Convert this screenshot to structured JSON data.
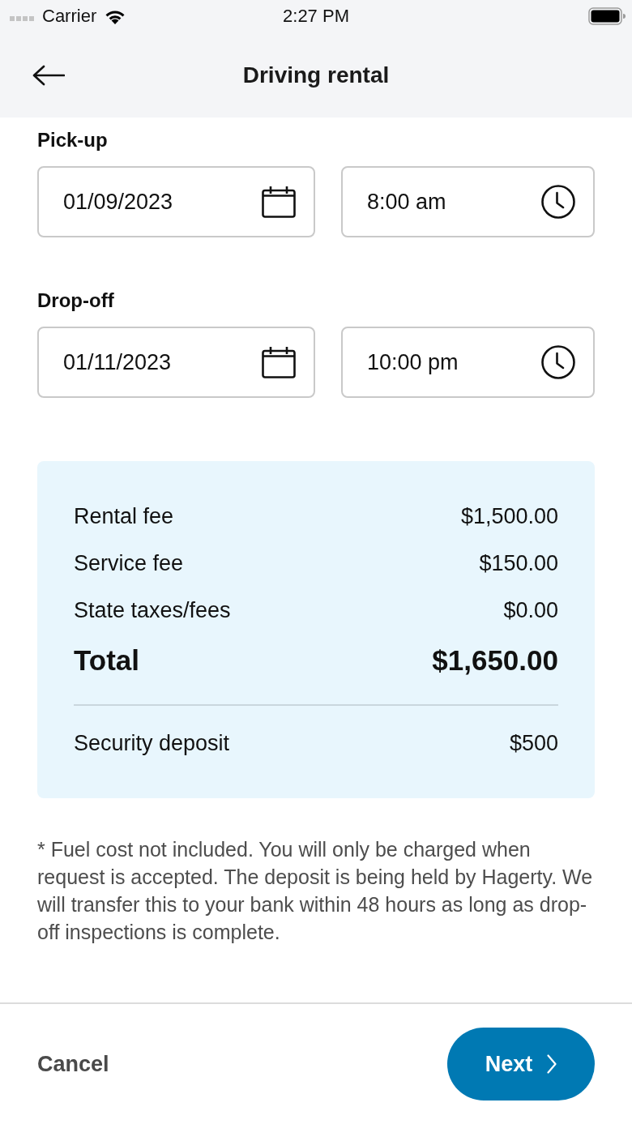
{
  "status_bar": {
    "carrier": "Carrier",
    "time": "2:27 PM"
  },
  "nav": {
    "title": "Driving rental"
  },
  "sections": [
    {
      "label": "Pick-up",
      "date": "01/09/2023",
      "time": "8:00 am"
    },
    {
      "label": "Drop-off",
      "date": "01/11/2023",
      "time": "10:00 pm"
    }
  ],
  "summary": {
    "lines": [
      {
        "kind": "fee",
        "label": "Rental fee",
        "amount": "$1,500.00"
      },
      {
        "kind": "fee",
        "label": "Service fee",
        "amount": "$150.00"
      },
      {
        "kind": "fee",
        "label": "State taxes/fees",
        "amount": "$0.00"
      },
      {
        "kind": "total",
        "label": "Total",
        "amount": "$1,650.00"
      },
      {
        "kind": "deposit",
        "label": "Security deposit",
        "amount": "$500"
      }
    ]
  },
  "disclaimer": "* Fuel cost not included. You will only be charged when request is accepted. The deposit is being held by Hagerty. We will transfer this to your bank within 48 hours as long as drop-off inspections is complete.",
  "footer": {
    "cancel": "Cancel",
    "next": "Next"
  }
}
